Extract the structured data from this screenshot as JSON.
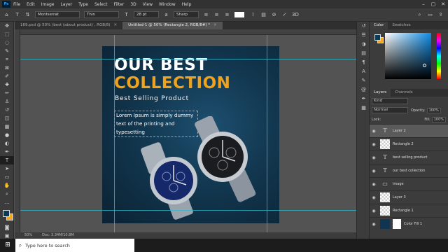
{
  "menu": {
    "logo": "Ps",
    "items": [
      "File",
      "Edit",
      "Image",
      "Layer",
      "Type",
      "Select",
      "Filter",
      "3D",
      "View",
      "Window",
      "Help"
    ],
    "window_controls": [
      "–",
      "▢",
      "✕"
    ]
  },
  "options": {
    "font_family": "Montserrat",
    "font_style": "Thin",
    "font_size": "28 pt",
    "anti_alias": "Sharp"
  },
  "tabs": [
    {
      "label": "169.psd @ 50% (best (about product) , RGB/8)",
      "active": false
    },
    {
      "label": "Untitled-1 @ 50% (Rectangle 2, RGB/8#) *",
      "active": true
    }
  ],
  "canvas": {
    "headline1": "OUR BEST",
    "headline2": "COLLECTION",
    "subtitle": "Best Selling Product",
    "lorem": "Lorem Ipsum is simply dummy text of the printing and typesetting"
  },
  "status": {
    "zoom": "50%",
    "doc": "Doc: 3.34M/10.8M"
  },
  "color_panel": {
    "tabs": [
      "Color",
      "Swatches"
    ]
  },
  "layers_panel": {
    "tabs": [
      "Layers",
      "Channels"
    ],
    "kind_label": "Kind",
    "blend_mode": "Normal",
    "opacity_label": "Opacity:",
    "opacity_value": "100%",
    "lock_label": "Lock:",
    "fill_label": "Fill:",
    "fill_value": "100%",
    "layers": [
      {
        "name": "Layer 2",
        "type": "text",
        "selected": true
      },
      {
        "name": "Rectangle 2",
        "type": "checker",
        "selected": false
      },
      {
        "name": "best selling product",
        "type": "text",
        "selected": false
      },
      {
        "name": "our best collection",
        "type": "text",
        "selected": false
      },
      {
        "name": "image",
        "type": "folder",
        "selected": false
      },
      {
        "name": "Layer 3",
        "type": "checker",
        "selected": false
      },
      {
        "name": "Rectangle 1",
        "type": "checker",
        "selected": false
      },
      {
        "name": "Color Fill 1",
        "type": "fill",
        "selected": false
      }
    ]
  },
  "taskbar": {
    "search_placeholder": "Type here to search"
  },
  "colors": {
    "foreground": "#0b3a55",
    "background": "#f3a623",
    "accent": "#f0a21c"
  }
}
